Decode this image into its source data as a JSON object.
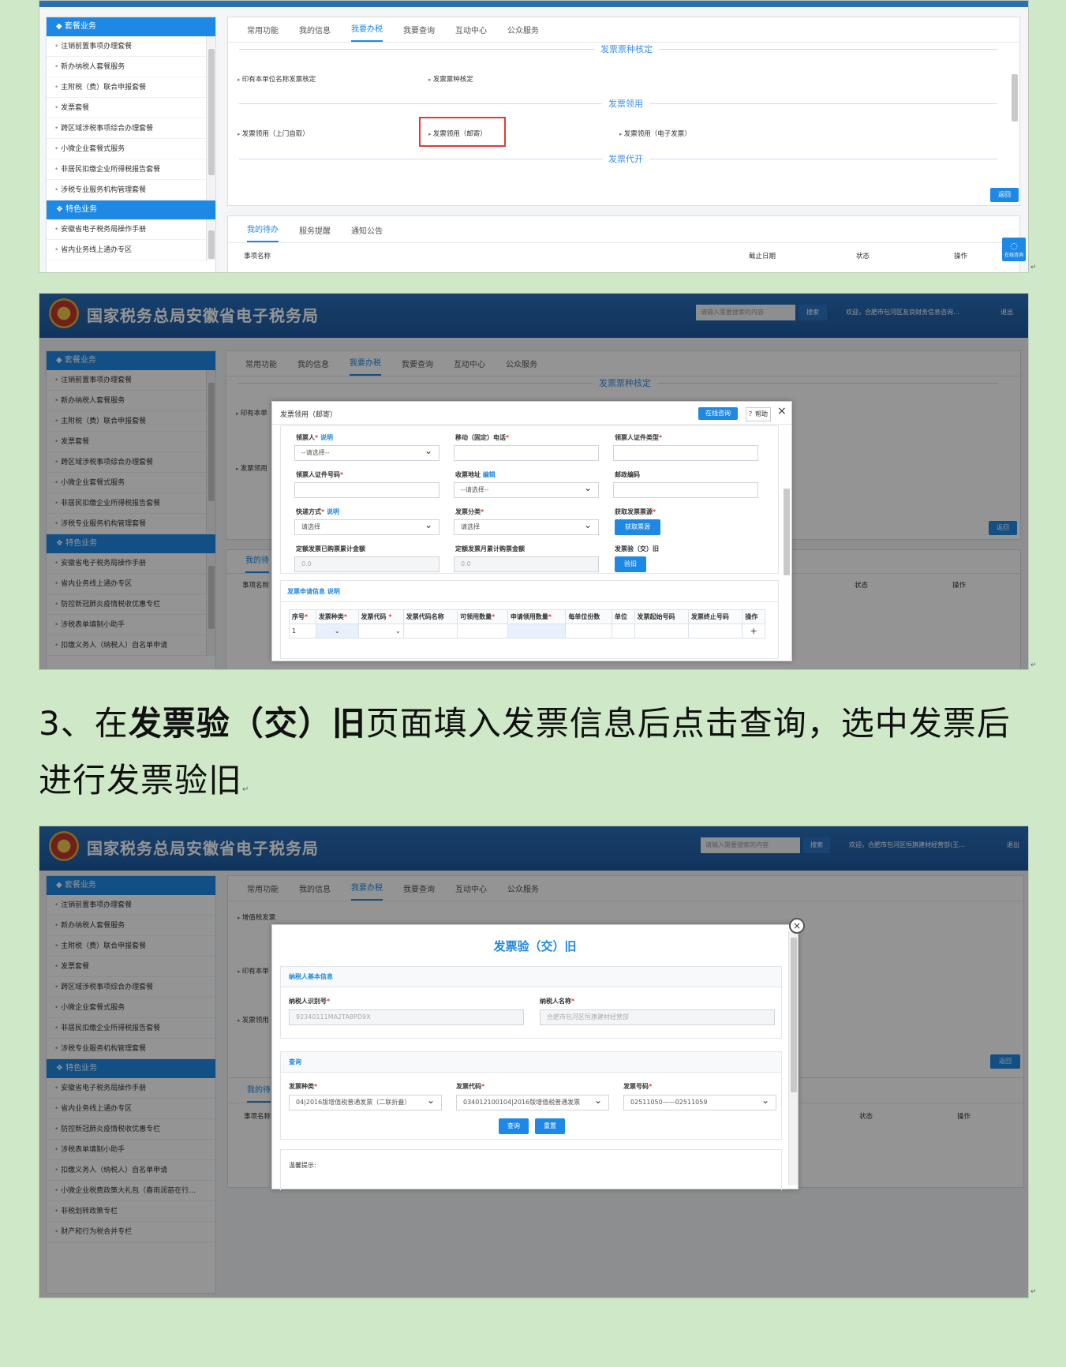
{
  "shot1": {
    "sidebar_header1": "套餐业务",
    "sidebar_items1": [
      "注销前置事项办理套餐",
      "新办纳税人套餐服务",
      "主附税（费）联合申报套餐",
      "发票套餐",
      "跨区域涉税事项综合办理套餐",
      "小微企业套餐式服务",
      "非居民扣缴企业所得税报告套餐",
      "涉税专业服务机构管理套餐"
    ],
    "sidebar_header2": "特色业务",
    "sidebar_items2": [
      "安徽省电子税务局操作手册",
      "省内业务线上通办专区"
    ],
    "tabs": [
      "常用功能",
      "我的信息",
      "我要办税",
      "我要查询",
      "互动中心",
      "公众服务"
    ],
    "section1": "发票票种核定",
    "section1_links": [
      "印有本单位名称发票核定",
      "发票票种核定"
    ],
    "section2": "发票领用",
    "section2_links": [
      "发票领用（上门自取）",
      "发票领用（邮寄）",
      "发票领用（电子发票）"
    ],
    "section3": "发票代开",
    "return_button": "返回",
    "bottom_tabs": [
      "我的待办",
      "服务提醒",
      "通知公告"
    ],
    "table_headers": [
      "事项名称",
      "截止日期",
      "状态",
      "操作"
    ],
    "consult": "在线咨询"
  },
  "shot2": {
    "site_title": "国家税务总局安徽省电子税务局",
    "search_placeholder": "请输入需要搜索的内容",
    "search_button": "搜索",
    "welcome": "欢迎，合肥市包河区友良财务信息咨询…",
    "logout": "退出",
    "sidebar_header1": "套餐业务",
    "sidebar_items1": [
      "注销前置事项办理套餐",
      "新办纳税人套餐服务",
      "主附税（费）联合申报套餐",
      "发票套餐",
      "跨区域涉税事项综合办理套餐",
      "小微企业套餐式服务",
      "非居民扣缴企业所得税报告套餐",
      "涉税专业服务机构管理套餐"
    ],
    "sidebar_header2": "特色业务",
    "sidebar_items2": [
      "安徽省电子税务局操作手册",
      "省内业务线上通办专区",
      "防控新冠肺炎疫情税收优惠专栏",
      "涉税表单填制小助手",
      "扣缴义务人（纳税人）自名单申请"
    ],
    "tabs": [
      "常用功能",
      "我的信息",
      "我要办税",
      "我要查询",
      "互动中心",
      "公众服务"
    ],
    "section1": "发票票种核定",
    "behind_link1": "印有本单",
    "behind_link2": "发票领用",
    "bottom_tab": "我的待",
    "row_label": "事项名称",
    "col_status": "状态",
    "col_op": "操作",
    "return_button": "返回",
    "dialog": {
      "title": "发票领用（邮寄）",
      "consult_button": "在线咨询",
      "help_button": "？帮助",
      "close": "×",
      "fields": {
        "receiver": "领票人",
        "explain": "说明",
        "receiver_select": "--请选择--",
        "phone": "移动（固定）电话",
        "id_type": "领票人证件类型",
        "id_no": "领票人证件号码",
        "address": "收票地址",
        "edit": "编辑",
        "address_select": "--请选择--",
        "postcode": "邮政编码",
        "express": "快递方式",
        "express_select": "请选择",
        "category": "发票分类",
        "category_select": "请选择",
        "source": "获取发票票源",
        "source_button": "获取票源",
        "quota_total": "定额发票已购票累计金额",
        "quota_total_value": "0.0",
        "quota_month": "定额发票月累计购票金额",
        "quota_month_value": "0.0",
        "check_old": "发票验（交）旧",
        "check_old_button": "验旧"
      },
      "apply_title": "发票申请信息",
      "apply_explain": "说明",
      "table_headers": [
        "序号",
        "发票种类",
        "发票代码",
        "发票代码名称",
        "可领用数量",
        "申请领用数量",
        "每单位份数",
        "单位",
        "发票起始号码",
        "发票终止号码",
        "操作"
      ],
      "row_no": "1",
      "add": "+"
    }
  },
  "instruction": {
    "prefix": "3、在",
    "bold": "发票验（交）旧",
    "suffix": "页面填入发票信息后点击查询，选中发票后",
    "line2": "进行发票验旧"
  },
  "shot3": {
    "site_title": "国家税务总局安徽省电子税务局",
    "search_placeholder": "请输入需要搜索的内容",
    "search_button": "搜索",
    "welcome": "欢迎，合肥市包河区恒旗建材经营部(王…",
    "logout": "退出",
    "sidebar_header1": "套餐业务",
    "sidebar_items1": [
      "注销前置事项办理套餐",
      "新办纳税人套餐服务",
      "主附税（费）联合申报套餐",
      "发票套餐",
      "跨区域涉税事项综合办理套餐",
      "小微企业套餐式服务",
      "非居民扣缴企业所得税报告套餐",
      "涉税专业服务机构管理套餐"
    ],
    "sidebar_header2": "特色业务",
    "sidebar_items2": [
      "安徽省电子税务局操作手册",
      "省内业务线上通办专区",
      "防控新冠肺炎疫情税收优惠专栏",
      "涉税表单填制小助手",
      "扣缴义务人（纳税人）自名单申请",
      "小微企业税费政策大礼包（春雨润苗在行…",
      "非税划转政策专栏",
      "财产和行为税合并专栏"
    ],
    "tabs": [
      "常用功能",
      "我的信息",
      "我要办税",
      "我要查询",
      "互动中心",
      "公众服务"
    ],
    "behind_link1": "增值税发票",
    "behind_link2": "印有本单",
    "behind_link3": "发票领用",
    "bottom_tab": "我的待",
    "row_label": "事项名称",
    "col_status": "状态",
    "col_op": "操作",
    "return_button": "返回",
    "dialog": {
      "title": "发票验（交）旧",
      "section_basic": "纳税人基本信息",
      "taxpayer_id_label": "纳税人识别号",
      "taxpayer_id": "92340111MA2TA8PD9X",
      "taxpayer_name_label": "纳税人名称",
      "taxpayer_name": "合肥市包河区恒旗建材经营部",
      "section_query": "查询",
      "type_label": "发票种类",
      "type_value": "04|2016版增值税普通发票（二联折叠）",
      "code_label": "发票代码",
      "code_value": "034012100104|2016版增值税普通发票",
      "number_label": "发票号码",
      "number_value": "02511050——02511059",
      "query_button": "查询",
      "reset_button": "重置",
      "tip_title": "温馨提示:"
    }
  }
}
